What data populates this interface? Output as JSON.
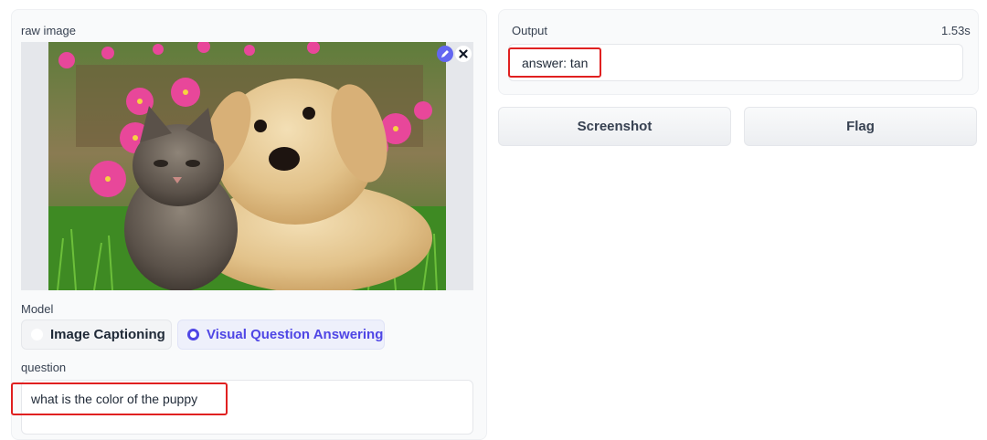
{
  "left": {
    "image_label": "raw image",
    "model_label": "Model",
    "model_options": [
      "Image Captioning",
      "Visual Question Answering"
    ],
    "selected_option": "Visual Question Answering",
    "question_label": "question",
    "question_value": "what is the color of the puppy"
  },
  "right": {
    "output_label": "Output",
    "timing": "1.53s",
    "output_value": "answer: tan",
    "screenshot_label": "Screenshot",
    "flag_label": "Flag"
  },
  "icons": {
    "edit": "pencil-icon",
    "close": "close-icon"
  },
  "colors": {
    "accent": "#4f46e5",
    "highlight": "#e02020"
  }
}
